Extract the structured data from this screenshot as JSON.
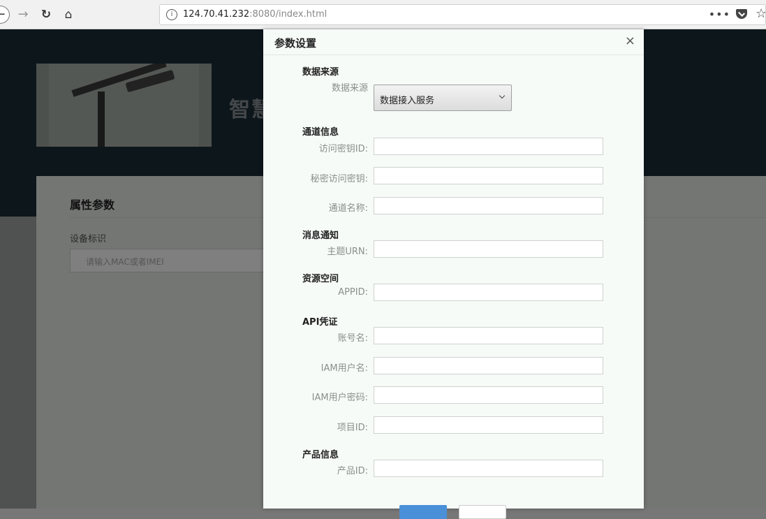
{
  "browser": {
    "url_host": "124.70.41.232",
    "url_rest": ":8080/index.html",
    "menu_dots": "•••"
  },
  "page": {
    "title": "智慧",
    "panel_heading": "属性参数",
    "device_label": "设备标识",
    "device_placeholder": "请输入MAC或者IMEI"
  },
  "modal": {
    "title": "参数设置",
    "close": "×",
    "sections": {
      "data_source": "数据来源",
      "channel": "通道信息",
      "message": "消息通知",
      "resource": "资源空间",
      "api": "API凭证",
      "product": "产品信息"
    },
    "labels": {
      "data_source": "数据来源",
      "access_key_id": "访问密钥ID:",
      "secret_key": "秘密访问密钥:",
      "channel_name": "通道名称:",
      "topic_urn": "主题URN:",
      "appid": "APPID:",
      "account": "账号名:",
      "iam_user": "IAM用户名:",
      "iam_pwd": "IAM用户密码:",
      "project_id": "项目ID:",
      "product_id": "产品ID:"
    },
    "select_value": "数据接入服务"
  }
}
